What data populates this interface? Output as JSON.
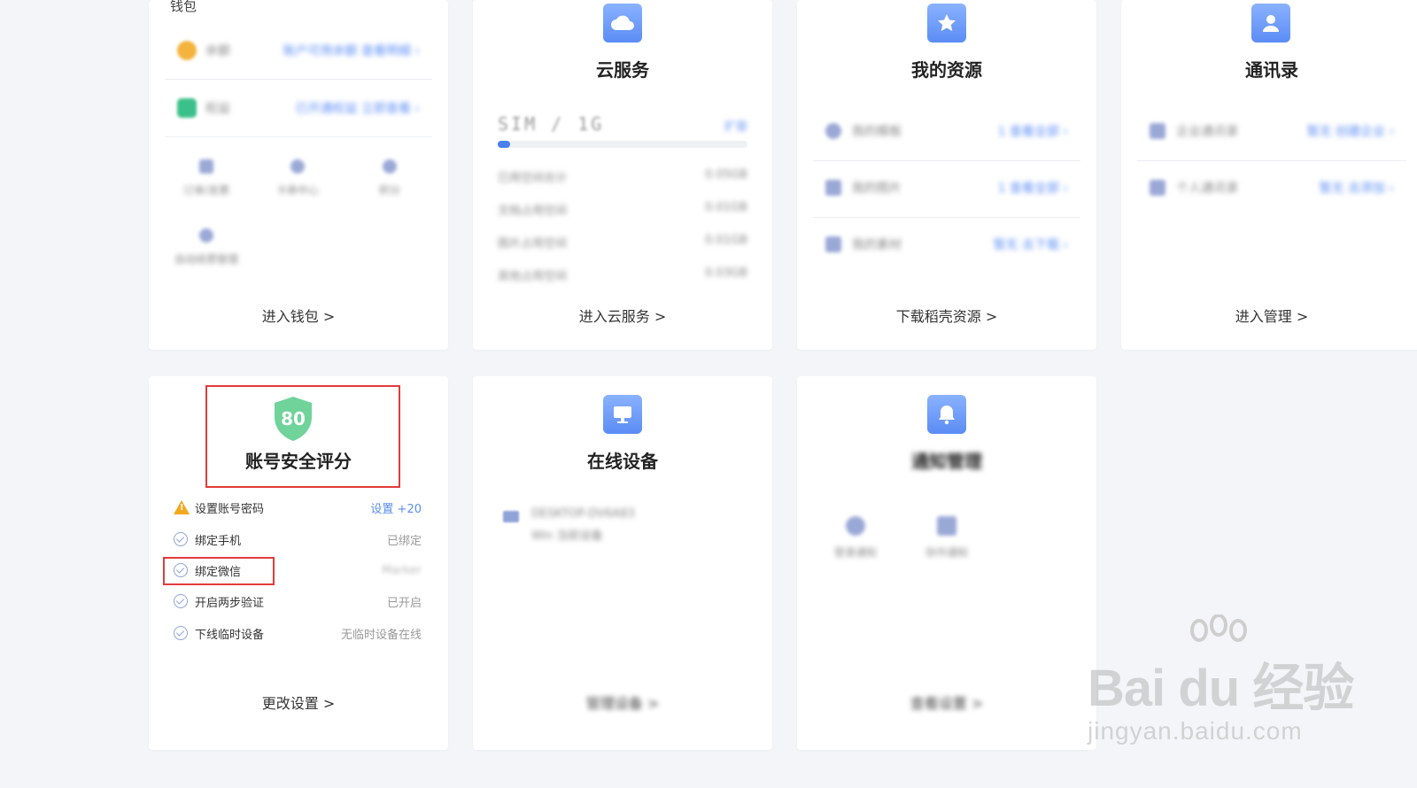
{
  "wallet": {
    "label": "钱包",
    "rows": [
      {
        "name": "余额",
        "detail": "账户可用余额 查看明细 ›"
      },
      {
        "name": "权益",
        "detail": "已开通权益 立即查看 ›"
      }
    ],
    "grid": [
      "订单/发票",
      "卡券中心",
      "积分",
      "自动续费管理"
    ],
    "link": "进入钱包 >"
  },
  "cloud": {
    "title": "云服务",
    "storage": "SIM / 1G",
    "storage_action": "扩容",
    "usage_fraction": 0.05,
    "stats": [
      {
        "label": "已用空间合计",
        "value": "0.05GB"
      },
      {
        "label": "文档占用空间",
        "value": "0.01GB"
      },
      {
        "label": "图片占用空间",
        "value": "0.01GB"
      },
      {
        "label": "其他占用空间",
        "value": "0.03GB"
      }
    ],
    "link": "进入云服务 >"
  },
  "resources": {
    "title": "我的资源",
    "rows": [
      {
        "name": "我的模板",
        "value": "1 查看全部 ›"
      },
      {
        "name": "我的图片",
        "value": "1 查看全部 ›"
      },
      {
        "name": "我的素材",
        "value": "暂无 去下载 ›"
      }
    ],
    "link": "下载稻壳资源 >"
  },
  "contacts": {
    "title": "通讯录",
    "rows": [
      {
        "name": "企业通讯录",
        "value": "暂无 创建企业 ›"
      },
      {
        "name": "个人通讯录",
        "value": "暂无 去添加 ›"
      }
    ],
    "link": "进入管理 >"
  },
  "security": {
    "score": "80",
    "title": "账号安全评分",
    "items": [
      {
        "label": "设置账号密码",
        "status": "设置 +20",
        "type": "warn"
      },
      {
        "label": "绑定手机",
        "status": "已绑定",
        "type": "ok"
      },
      {
        "label": "绑定微信",
        "status": "Marker",
        "type": "ok"
      },
      {
        "label": "开启两步验证",
        "status": "已开启",
        "type": "ok"
      },
      {
        "label": "下线临时设备",
        "status": "无临时设备在线",
        "type": "ok"
      }
    ],
    "link": "更改设置 >"
  },
  "devices": {
    "title": "在线设备",
    "device_name": "DESKTOP-DV6A83",
    "device_sub": "Win 当前设备",
    "link": "管理设备 >"
  },
  "notify": {
    "title": "通知管理",
    "items": [
      "登录通知",
      "协作通知"
    ],
    "link": "查看设置 >"
  },
  "watermark": {
    "brand": "Bai du 经验",
    "url": "jingyan.baidu.com"
  },
  "colors": {
    "accent": "#5b8cf5",
    "highlight_red": "#e23b3b",
    "shield_green": "#6fd39a",
    "background": "#f4f5f8"
  }
}
